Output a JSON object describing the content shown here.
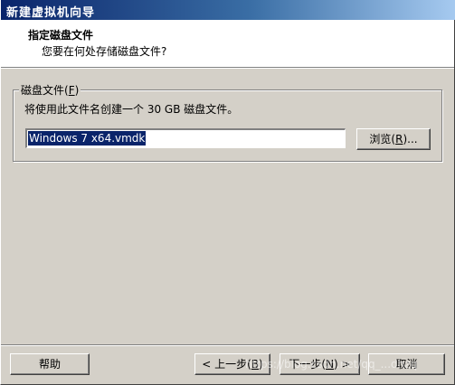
{
  "window": {
    "title": "新建虚拟机向导"
  },
  "header": {
    "title": "指定磁盘文件",
    "subtitle": "您要在何处存储磁盘文件?"
  },
  "disk_group": {
    "legend_prefix": "磁盘文件(",
    "legend_key": "F",
    "legend_suffix": ")",
    "description": "将使用此文件名创建一个 30 GB 磁盘文件。",
    "file_value": "Windows 7 x64.vmdk",
    "browse_prefix": "浏览(",
    "browse_key": "R",
    "browse_suffix": ")..."
  },
  "footer": {
    "help_label": "帮助",
    "back_prefix": "< 上一步(",
    "back_key": "B",
    "back_suffix": ")",
    "next_prefix": "下一步(",
    "next_key": "N",
    "next_suffix": ") >",
    "cancel_label": "取消"
  },
  "watermark": "https://blog.csdn.net/qq_...dhzq",
  "colors": {
    "titlebar_start": "#0a246a",
    "titlebar_end": "#a6caf0",
    "dialog_bg": "#d4d0c8",
    "selection": "#0a246a"
  }
}
